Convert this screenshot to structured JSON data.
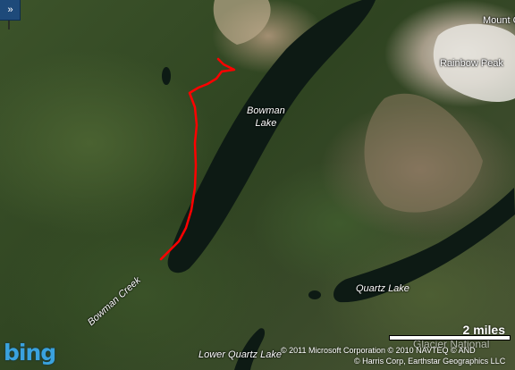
{
  "map": {
    "type": "satellite",
    "provider_logo": "bing",
    "expand_button_icon": "double-chevron-right-icon",
    "expand_button_glyph": "»",
    "labels": {
      "bowman_lake_line1": "Bowman",
      "bowman_lake_line2": "Lake",
      "rainbow_peak": "Rainbow Peak",
      "mount_c": "Mount C",
      "quartz_lake": "Quartz Lake",
      "lower_quartz_lake": "Lower Quartz Lake",
      "bowman_creek": "Bowman Creek",
      "glacier_national": "Glacier National"
    },
    "scale": {
      "label": "2 miles"
    },
    "copyright": {
      "line1": "© 2011 Microsoft Corporation   © 2010 NAVTEQ   © AND",
      "line2": "© Harris Corp, Earthstar Geographics LLC"
    },
    "route": {
      "color": "#ff0000",
      "marker_icon": "green-pin-icon",
      "marker_color": "#2aa82a"
    },
    "colors": {
      "lake": "#0d1a14",
      "logo": "#3aa2de"
    }
  }
}
